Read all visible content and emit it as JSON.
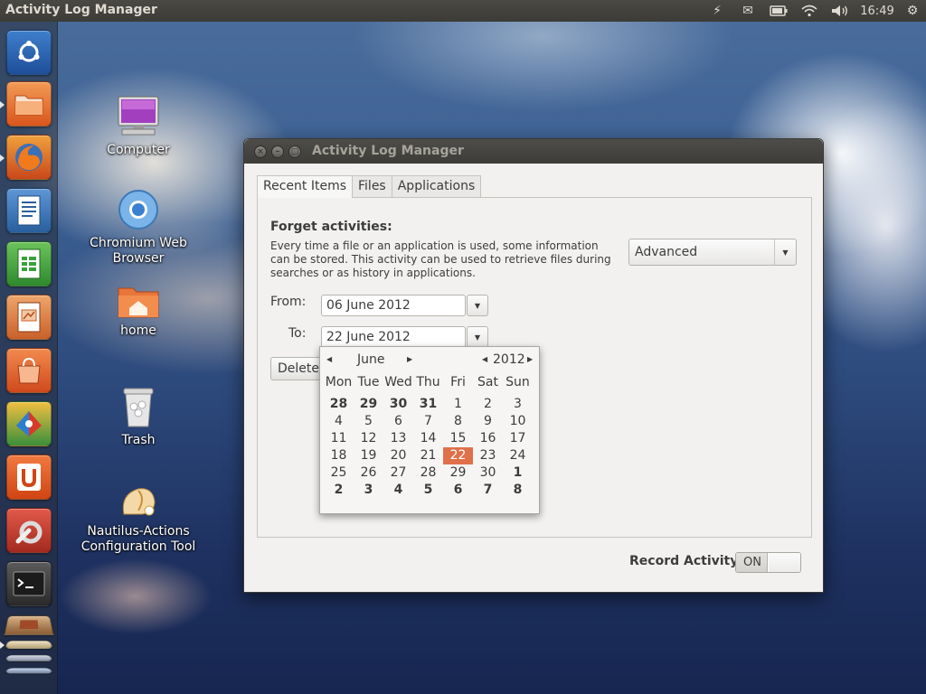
{
  "top_panel": {
    "app_title": "Activity Log Manager",
    "indicators": [
      {
        "name": "power-icon",
        "glyph": "⚡"
      },
      {
        "name": "mail-icon",
        "glyph": "✉"
      },
      {
        "name": "battery-icon",
        "glyph": "▭"
      },
      {
        "name": "wifi-icon",
        "glyph": "◠"
      },
      {
        "name": "volume-icon",
        "glyph": "🔊"
      }
    ],
    "clock": "16:49",
    "system_menu_icon": "⚙"
  },
  "launcher": {
    "items": [
      {
        "name": "dash-home",
        "glyph": "◎",
        "color": "#2a6bb8"
      },
      {
        "name": "files",
        "glyph": "▭",
        "color": "#e8692e"
      },
      {
        "name": "firefox",
        "glyph": "◉",
        "color": "#e05a1b"
      },
      {
        "name": "libreoffice-writer",
        "glyph": "≡",
        "color": "#3f78c0"
      },
      {
        "name": "libreoffice-calc",
        "glyph": "▦",
        "color": "#3aa03c"
      },
      {
        "name": "libreoffice-impress",
        "glyph": "▣",
        "color": "#d9743a"
      },
      {
        "name": "ubuntu-software-center",
        "glyph": "◈",
        "color": "#e05c25"
      },
      {
        "name": "app-tile",
        "glyph": "◆",
        "color": "#c44a2a"
      },
      {
        "name": "ubuntu-one",
        "glyph": "U",
        "color": "#e05420"
      },
      {
        "name": "system-settings",
        "glyph": "✦",
        "color": "#c8372b"
      },
      {
        "name": "terminal",
        "glyph": ">_",
        "color": "#3b3b3b"
      }
    ]
  },
  "desktop": {
    "icons": [
      {
        "label": "Computer"
      },
      {
        "label": "Chromium Web Browser"
      },
      {
        "label": "home"
      },
      {
        "label": "Trash"
      },
      {
        "label": "Nautilus-Actions Configuration Tool"
      }
    ]
  },
  "window": {
    "title": "Activity Log Manager",
    "tabs": [
      {
        "label": "Recent Items",
        "active": true
      },
      {
        "label": "Files",
        "active": false
      },
      {
        "label": "Applications",
        "active": false
      }
    ],
    "section_title": "Forget activities:",
    "description": "Every time a file or an application is used, some information can be stored. This activity can be used to retrieve files during searches or as history in applications.",
    "mode_combo": "Advanced",
    "from_label": "From:",
    "from_value": "06 June 2012",
    "to_label": "To:",
    "to_value": "22 June 2012",
    "delete_button": "Delete",
    "record_label": "Record Activity",
    "switch_state": "ON"
  },
  "calendar": {
    "month": "June",
    "year": "2012",
    "day_names": [
      "Mon",
      "Tue",
      "Wed",
      "Thu",
      "Fri",
      "Sat",
      "Sun"
    ],
    "weeks": [
      [
        "28",
        "29",
        "30",
        "31",
        "1",
        "2",
        "3"
      ],
      [
        "4",
        "5",
        "6",
        "7",
        "8",
        "9",
        "10"
      ],
      [
        "11",
        "12",
        "13",
        "14",
        "15",
        "16",
        "17"
      ],
      [
        "18",
        "19",
        "20",
        "21",
        "22",
        "23",
        "24"
      ],
      [
        "25",
        "26",
        "27",
        "28",
        "29",
        "30",
        "1"
      ],
      [
        "2",
        "3",
        "4",
        "5",
        "6",
        "7",
        "8"
      ]
    ],
    "selected_day": "22",
    "accent_color": "#e0704a"
  }
}
